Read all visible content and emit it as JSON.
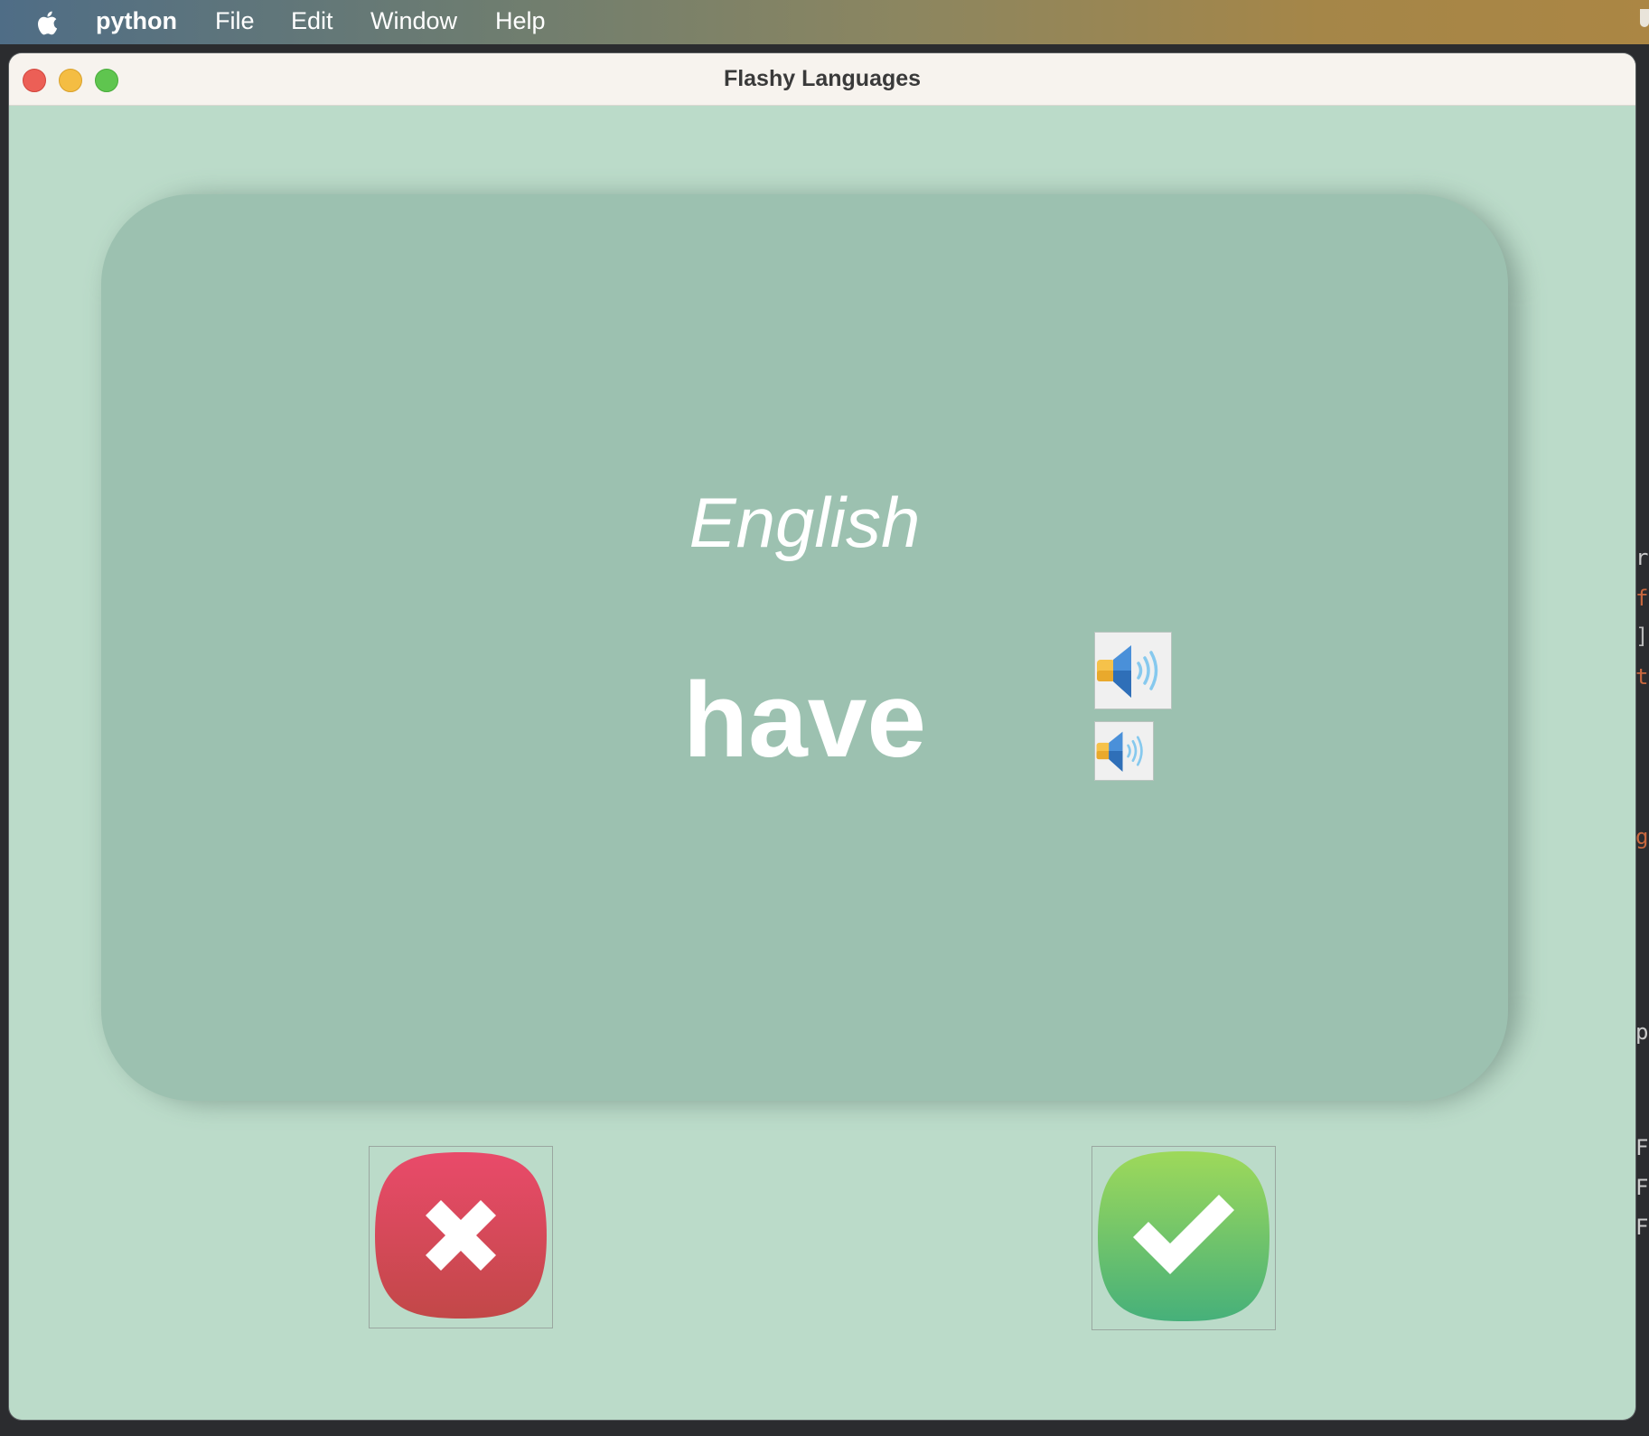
{
  "menubar": {
    "app_name": "python",
    "items": [
      "File",
      "Edit",
      "Window",
      "Help"
    ]
  },
  "window": {
    "title": "Flashy Languages"
  },
  "card": {
    "language": "English",
    "word": "have",
    "background_color": "#9cc1b0"
  },
  "app": {
    "background_color": "#bbdbc9"
  },
  "buttons": {
    "wrong_icon": "x-mark-icon",
    "right_icon": "check-mark-icon",
    "speaker_icon": "speaker-icon"
  }
}
